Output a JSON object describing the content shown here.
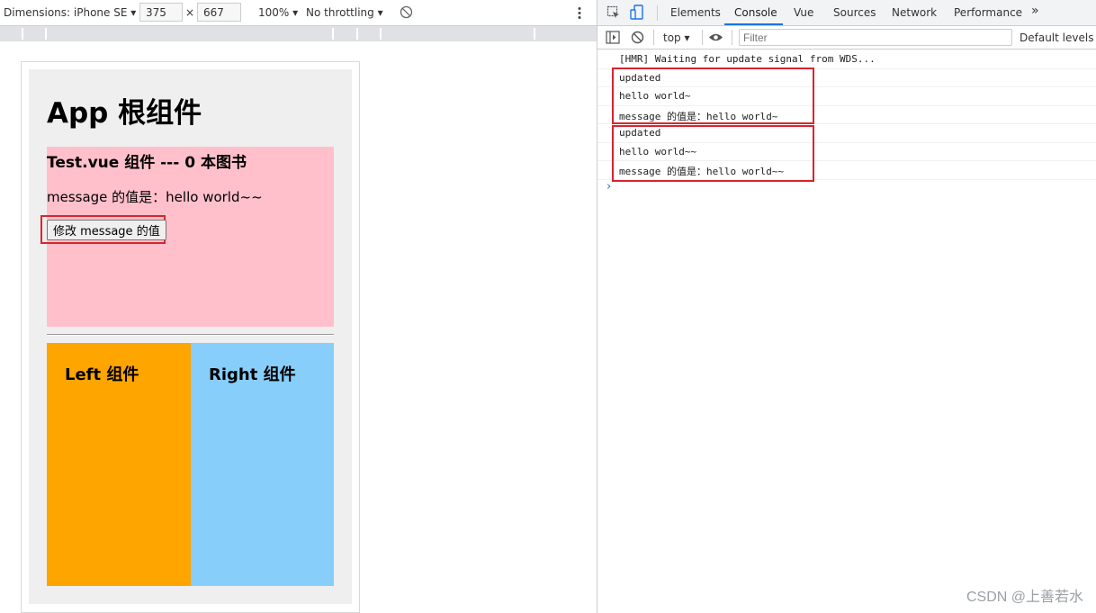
{
  "emulation_toolbar": {
    "dimensions_label": "Dimensions: iPhone SE ▾",
    "width": "375",
    "times": "×",
    "height": "667",
    "zoom": "100% ▾",
    "throttling": "No throttling ▾"
  },
  "app": {
    "title": "App 根组件",
    "test_title": "Test.vue 组件 --- 0 本图书",
    "test_message": "message 的值是：hello world~~",
    "modify_button": "修改 message 的值",
    "left_title": "Left 组件",
    "right_title": "Right 组件",
    "colors": {
      "test_bg": "#ffc0cb",
      "left_bg": "#ffa500",
      "right_bg": "#87cefa",
      "root_bg": "#efefef"
    }
  },
  "devtools": {
    "tabs": [
      "Elements",
      "Console",
      "Vue",
      "Sources",
      "Network",
      "Performance"
    ],
    "active_tab": "Console",
    "more_tabs": "»",
    "context": "top ▾",
    "filter_placeholder": "Filter",
    "levels": "Default levels ▾",
    "console_lines": [
      "[HMR] Waiting for update signal from WDS...",
      "updated",
      "hello world~",
      "message 的值是：hello world~",
      "updated",
      "hello world~~",
      "message 的值是：hello world~~"
    ],
    "prompt": "›",
    "highlight_color": "#d9242f"
  },
  "watermark": "CSDN @上善若水"
}
